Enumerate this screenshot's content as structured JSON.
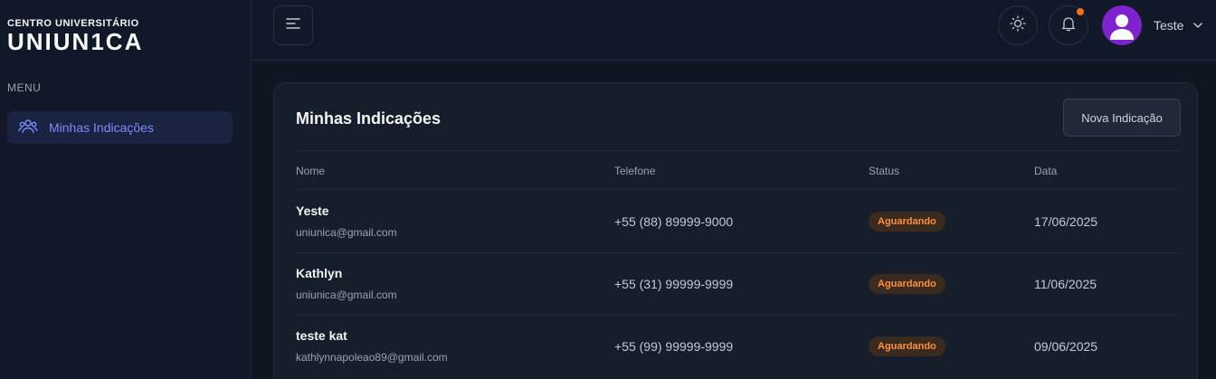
{
  "brand": {
    "subtitle": "CENTRO UNIVERSITÁRIO",
    "name": "UNIUN1CA"
  },
  "sidebar": {
    "menu_label": "MENU",
    "items": [
      {
        "label": "Minhas Indicações",
        "icon": "users-icon",
        "active": true
      }
    ]
  },
  "header": {
    "user_name": "Teste",
    "notification_dot_color": "#f97316",
    "avatar_color": "#7e22ce"
  },
  "main": {
    "title": "Minhas Indicações",
    "new_button": "Nova Indicação",
    "table": {
      "columns": [
        "Nome",
        "Telefone",
        "Status",
        "Data"
      ],
      "rows": [
        {
          "name": "Yeste",
          "email": "uniunica@gmail.com",
          "phone": "+55 (88) 89999-9000",
          "status": "Aguardando",
          "date": "17/06/2025"
        },
        {
          "name": "Kathlyn",
          "email": "uniunica@gmail.com",
          "phone": "+55 (31) 99999-9999",
          "status": "Aguardando",
          "date": "11/06/2025"
        },
        {
          "name": "teste kat",
          "email": "kathlynnapoleao89@gmail.com",
          "phone": "+55 (99) 99999-9999",
          "status": "Aguardando",
          "date": "09/06/2025"
        }
      ]
    }
  },
  "colors": {
    "accent": "#7c8cf8",
    "status_pending": "#fb923c"
  }
}
